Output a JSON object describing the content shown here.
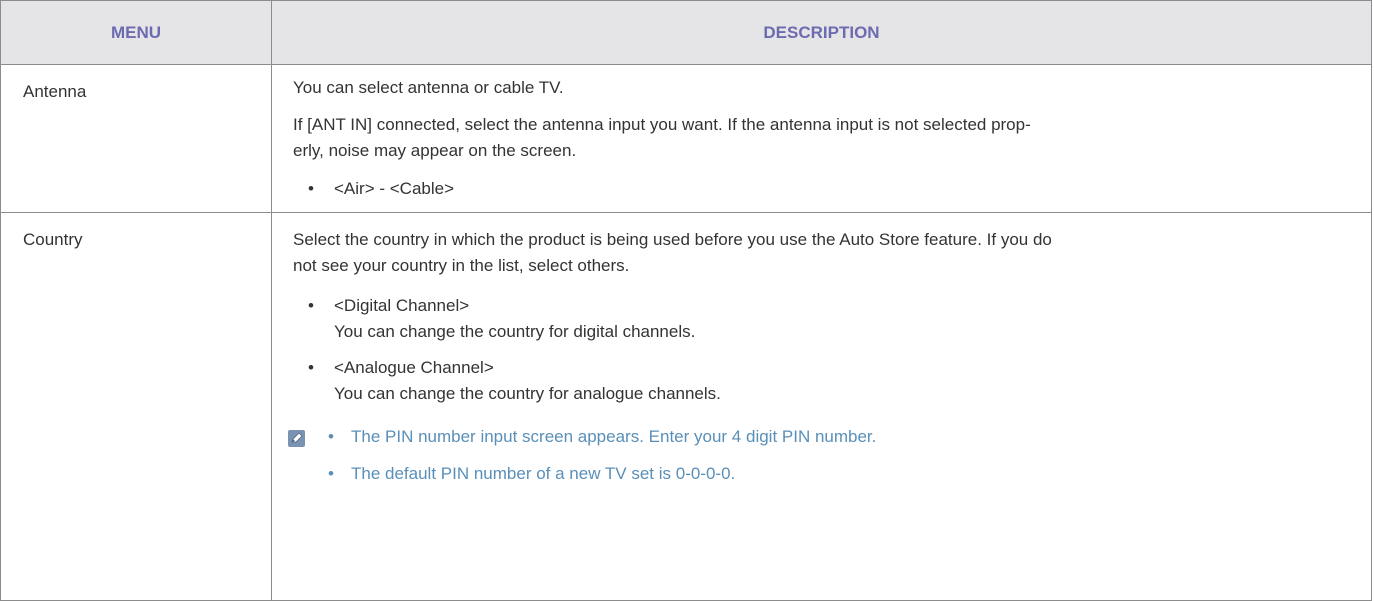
{
  "header": {
    "menu": "MENU",
    "description": "DESCRIPTION"
  },
  "rows": [
    {
      "menu": "Antenna",
      "paragraphs": [
        "You can select antenna or cable TV.",
        "If [ANT IN] connected, select the antenna input you want. If the antenna input is not selected prop-",
        "erly, noise may appear on the screen."
      ],
      "bullets": [
        {
          "title": "<Air> - <Cable>"
        }
      ]
    },
    {
      "menu": "Country",
      "paragraphs": [
        "Select the country in which the product is being used before you use the Auto Store feature. If you do",
        "not see your country in the list, select others."
      ],
      "bullets": [
        {
          "title": "<Digital Channel>",
          "text": "You can change the country for digital channels."
        },
        {
          "title": "<Analogue Channel>",
          "text": "You can change the country for analogue channels."
        }
      ],
      "notes": [
        "The PIN number input screen appears. Enter your 4 digit PIN number.",
        "The default PIN number of a new TV set is 0-0-0-0."
      ]
    }
  ],
  "bullet_char": "•",
  "colors": {
    "header_bg": "#e5e5e8",
    "header_text": "#6d6baf",
    "note_text": "#5a8fb8",
    "note_icon": "#7b93b3"
  },
  "icons": {
    "note": "pencil-note-icon"
  }
}
